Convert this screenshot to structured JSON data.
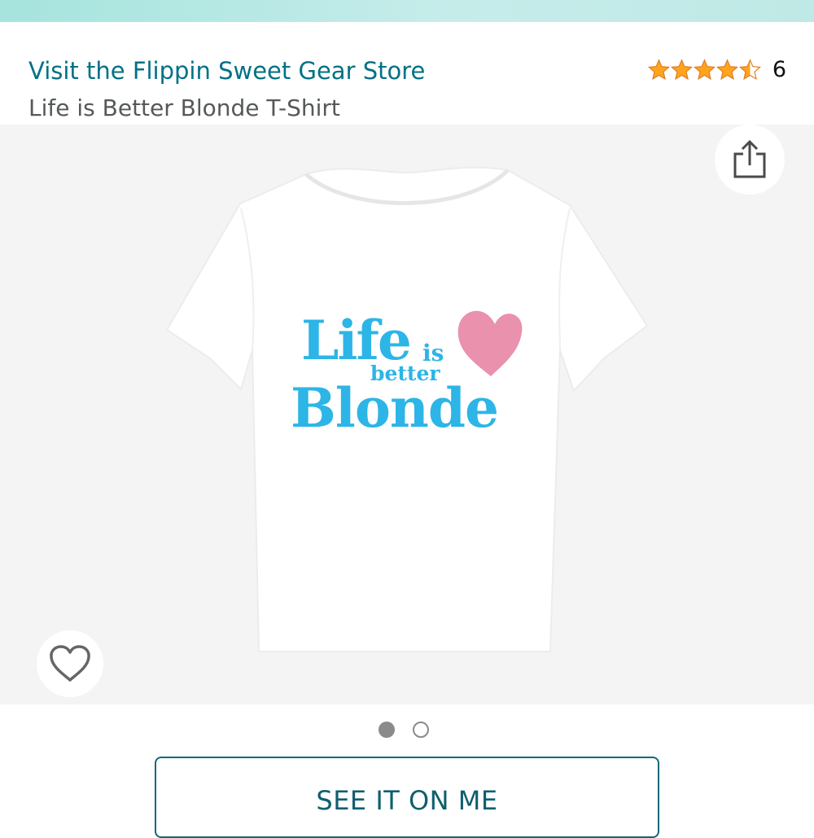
{
  "store": {
    "link_text": "Visit the Flippin Sweet Gear Store"
  },
  "rating": {
    "stars": 4.5,
    "max_stars": 5,
    "count": "6",
    "star_color": "#ffa41c"
  },
  "product": {
    "title": "Life is Better Blonde T-Shirt"
  },
  "shirt_graphic": {
    "line1": "Life",
    "line2": "is",
    "line3": "better",
    "line4": "Blonde",
    "text_color": "#2cb5e6",
    "heart_color": "#e991ad"
  },
  "gallery": {
    "image_count": 2,
    "active_index": 0
  },
  "actions": {
    "share_icon": "share-icon",
    "wishlist_icon": "heart-outline-icon",
    "see_it_on_me": "SEE IT ON ME"
  },
  "colors": {
    "link": "#007185",
    "top_bar": "#bfe9e6"
  }
}
